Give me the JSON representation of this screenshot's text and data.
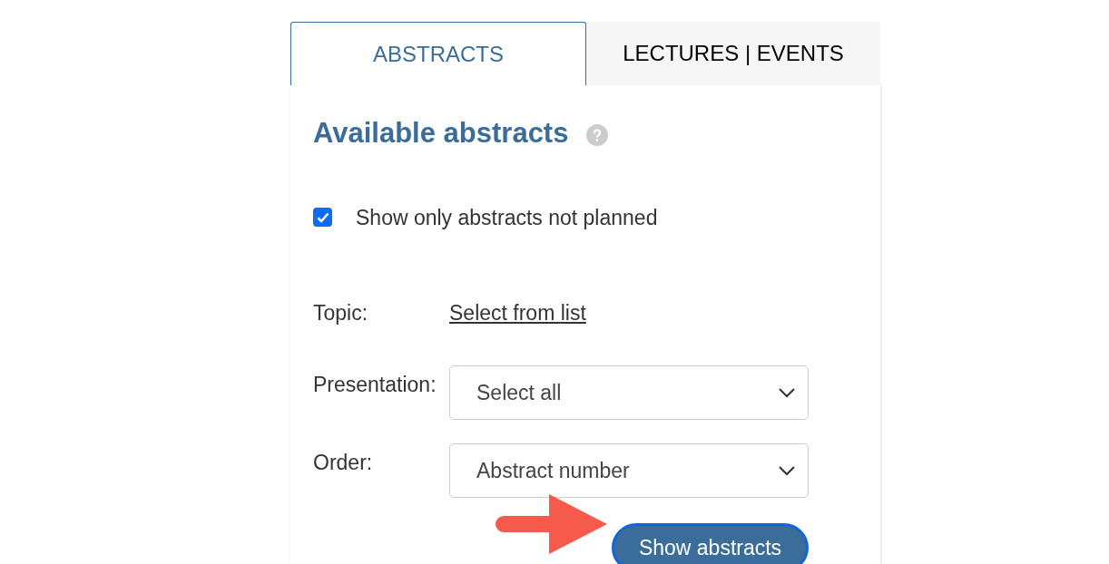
{
  "tabs": [
    {
      "label": "ABSTRACTS",
      "selected": true
    },
    {
      "label": "LECTURES | EVENTS",
      "selected": false
    }
  ],
  "panel": {
    "title": "Available abstracts",
    "filter_checkbox": {
      "label": "Show only abstracts not planned",
      "checked": true
    },
    "fields": [
      {
        "kind": "link",
        "label": "Topic:",
        "value": "Select from list"
      },
      {
        "kind": "select",
        "label": "Presentation:",
        "value": "Select all"
      },
      {
        "kind": "select",
        "label": "Order:",
        "value": "Abstract number"
      }
    ],
    "submit_button": "Show abstracts"
  }
}
